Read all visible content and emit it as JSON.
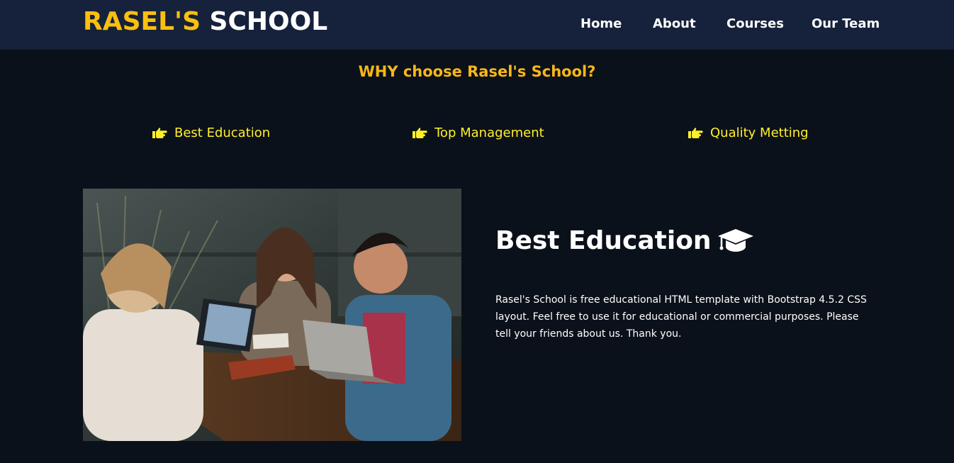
{
  "brand": {
    "part1": "RASEL'S",
    "part2": "SCHOOL"
  },
  "nav": {
    "items": [
      {
        "label": "Home"
      },
      {
        "label": "About"
      },
      {
        "label": "Courses"
      },
      {
        "label": "Our Team"
      }
    ]
  },
  "why": {
    "title": "WHY choose Rasel's School?"
  },
  "features": [
    {
      "label": "Best Education"
    },
    {
      "label": "Top Management"
    },
    {
      "label": "Quality Metting"
    }
  ],
  "content": {
    "heading": "Best Education",
    "paragraph": "Rasel's School is free educational HTML template with Bootstrap 4.5.2 CSS layout. Feel free to use it for educational or commercial purposes. Please tell your friends about us. Thank you."
  },
  "icons": {
    "feature": "hand-pointing-right-icon",
    "heading": "graduation-cap-icon"
  },
  "colors": {
    "navbar": "#16213b",
    "background": "#0b111a",
    "brand_accent": "#fbbf0f",
    "why_title": "#f7b718",
    "feature_text": "#ffef2a"
  }
}
